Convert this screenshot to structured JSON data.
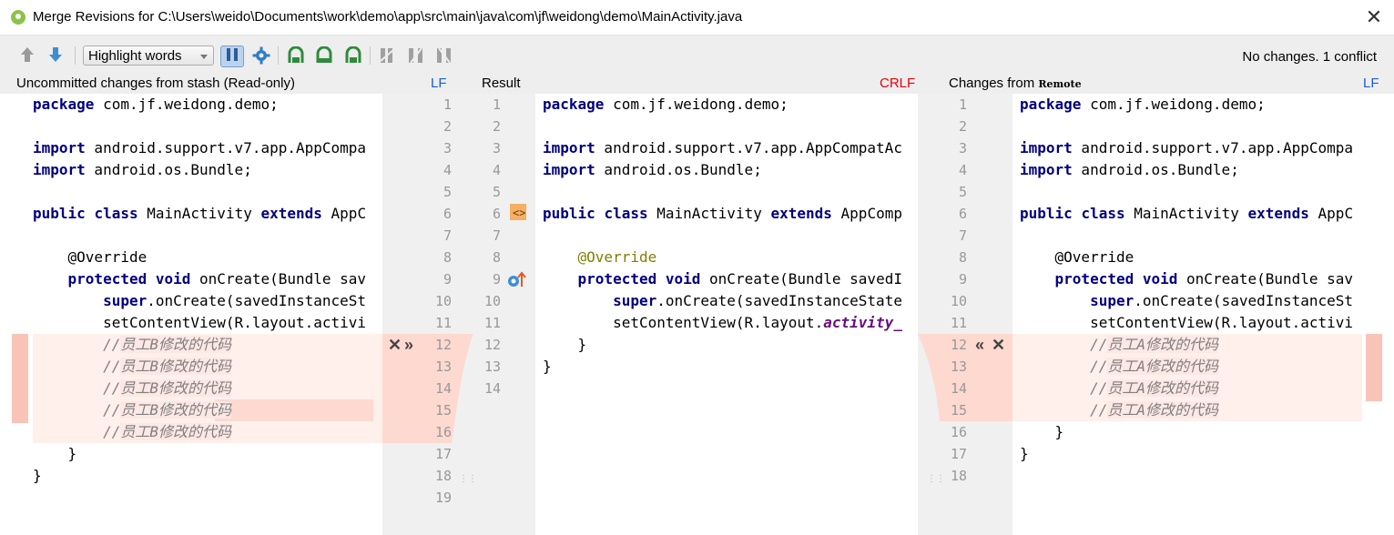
{
  "window": {
    "title": "Merge Revisions for C:\\Users\\weido\\Documents\\work\\demo\\app\\src\\main\\java\\com\\jf\\weidong\\demo\\MainActivity.java",
    "close_glyph": "✕"
  },
  "toolbar": {
    "highlight_mode": "Highlight words",
    "status": "No changes. 1 conflict"
  },
  "panels": {
    "left": {
      "label": "Uncommitted changes from stash (Read-only)",
      "line_sep": "LF"
    },
    "center": {
      "label": "Result",
      "line_sep": "CRLF"
    },
    "right": {
      "label_prefix": "Changes from",
      "label_suffix": "Remote",
      "line_sep": "LF"
    }
  },
  "left_lines": [
    "package com.jf.weidong.demo;",
    "",
    "import android.support.v7.app.AppCompa",
    "import android.os.Bundle;",
    "",
    "public class MainActivity extends AppC",
    "",
    "    @Override",
    "    protected void onCreate(Bundle sav",
    "        super.onCreate(savedInstanceSt",
    "        setContentView(R.layout.activi",
    "        //员工B修改的代码",
    "        //员工B修改的代码",
    "        //员工B修改的代码",
    "        //员工B修改的代码",
    "        //员工B修改的代码",
    "    }",
    "}",
    ""
  ],
  "center_lines": [
    "package com.jf.weidong.demo;",
    "",
    "import android.support.v7.app.AppCompatAc",
    "import android.os.Bundle;",
    "",
    "public class MainActivity extends AppComp",
    "",
    "    @Override",
    "    protected void onCreate(Bundle savedI",
    "        super.onCreate(savedInstanceState",
    "        setContentView(R.layout.activity_",
    "    }",
    "}",
    ""
  ],
  "right_lines": [
    "package com.jf.weidong.demo;",
    "",
    "import android.support.v7.app.AppCompa",
    "import android.os.Bundle;",
    "",
    "public class MainActivity extends AppC",
    "",
    "    @Override",
    "    protected void onCreate(Bundle sav",
    "        super.onCreate(savedInstanceSt",
    "        setContentView(R.layout.activi",
    "        //员工A修改的代码",
    "        //员工A修改的代码",
    "        //员工A修改的代码",
    "        //员工A修改的代码",
    "    }",
    "}",
    ""
  ],
  "gutter_numbers": {
    "left": [
      1,
      2,
      3,
      4,
      5,
      6,
      7,
      8,
      9,
      10,
      11,
      12,
      13,
      14,
      15,
      16,
      17,
      18,
      19
    ],
    "center": [
      1,
      2,
      3,
      4,
      5,
      6,
      7,
      8,
      9,
      10,
      11,
      12,
      13,
      14
    ],
    "right": [
      1,
      2,
      3,
      4,
      5,
      6,
      7,
      8,
      9,
      10,
      11,
      12,
      13,
      14,
      15,
      16,
      17,
      18
    ]
  },
  "conflict_controls": {
    "left_reject": "✕",
    "left_apply": "»",
    "right_apply": "«",
    "right_reject": "✕"
  },
  "colors": {
    "conflict_bg": "#fce8e4",
    "conflict_marker": "#f8c4b8",
    "line_sep_color": "#1a5fd1",
    "crlf_color": "#e8000b"
  }
}
